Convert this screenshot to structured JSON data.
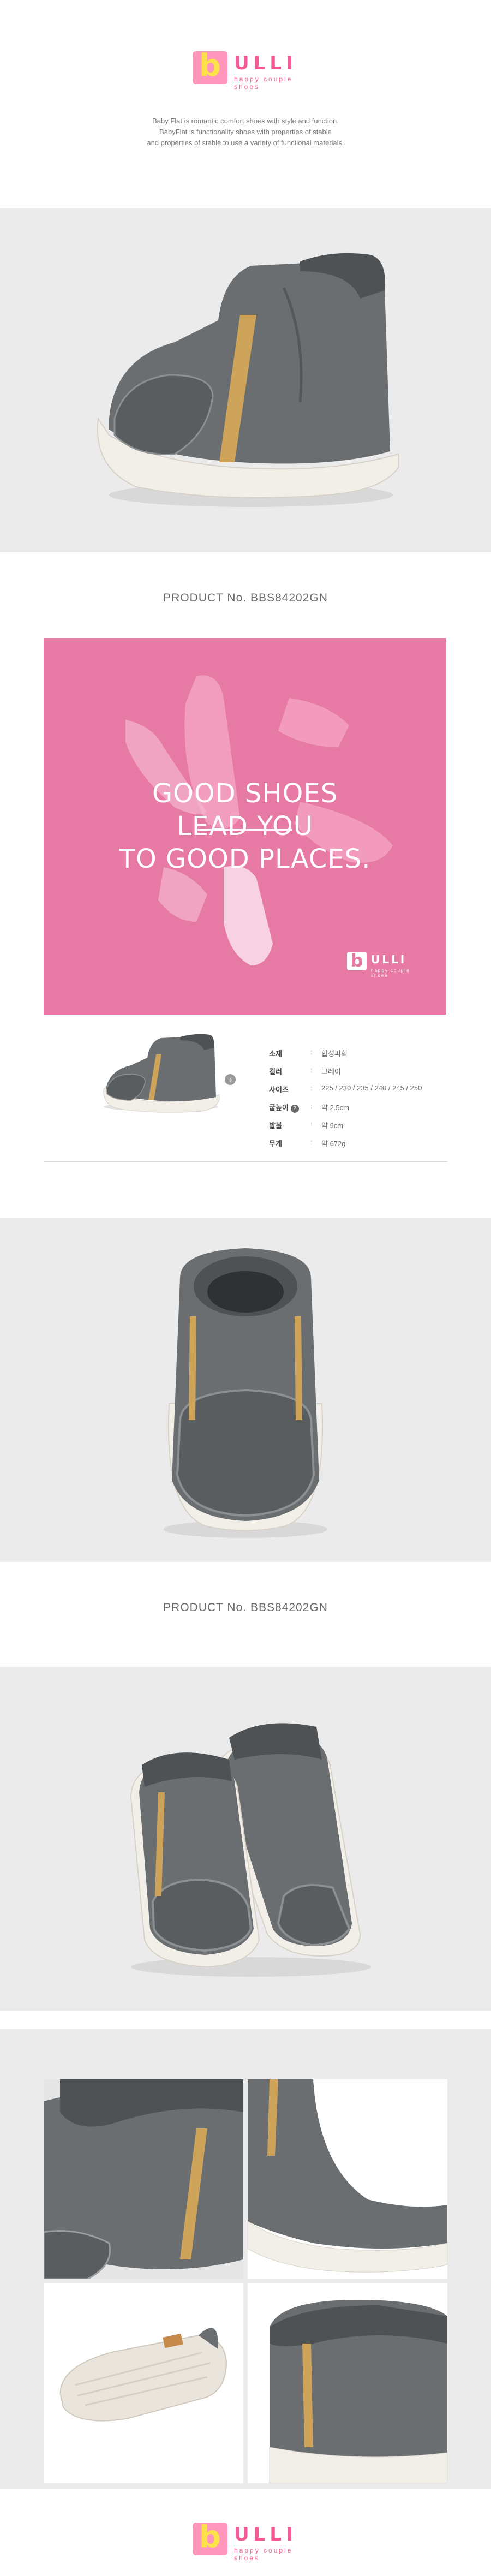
{
  "brand": {
    "letter": "b",
    "name": "ULLI",
    "tagline": "happy couple shoes"
  },
  "intro": {
    "line1": "Baby Flat is romantic comfort shoes with style and function.",
    "line2": "BabyFlat is functionality shoes with properties of stable",
    "line3": "and properties of stable to use a variety of functional materials."
  },
  "product_no_1": "PRODUCT No. BBS84202GN",
  "product_no_2": "PRODUCT No. BBS84202GN",
  "promo": {
    "line1": "GOOD SHOES",
    "line2": "LEAD YOU",
    "line3": "TO GOOD PLACES."
  },
  "spec": {
    "rows": [
      {
        "key": "소재",
        "value": "합성피혁"
      },
      {
        "key": "컬러",
        "value": "그레이"
      },
      {
        "key": "사이즈",
        "value": "225 / 230 / 235 / 240 / 245 / 250"
      },
      {
        "key": "굽높이",
        "value": "약 2.5cm",
        "help": "?"
      },
      {
        "key": "발볼",
        "value": "약 9cm"
      },
      {
        "key": "무게",
        "value": "약 672g"
      }
    ],
    "separator": ":",
    "zoom": "+"
  },
  "colors": {
    "pink_bg": "#e77aa4",
    "brand_pink": "#f45b95",
    "logo_yellow": "#ffe14a",
    "panel_gray": "#ebebeb",
    "shoe_gray": "#6b6e71"
  },
  "icons": [
    "zoom-plus-icon",
    "help-icon",
    "logo-icon"
  ]
}
